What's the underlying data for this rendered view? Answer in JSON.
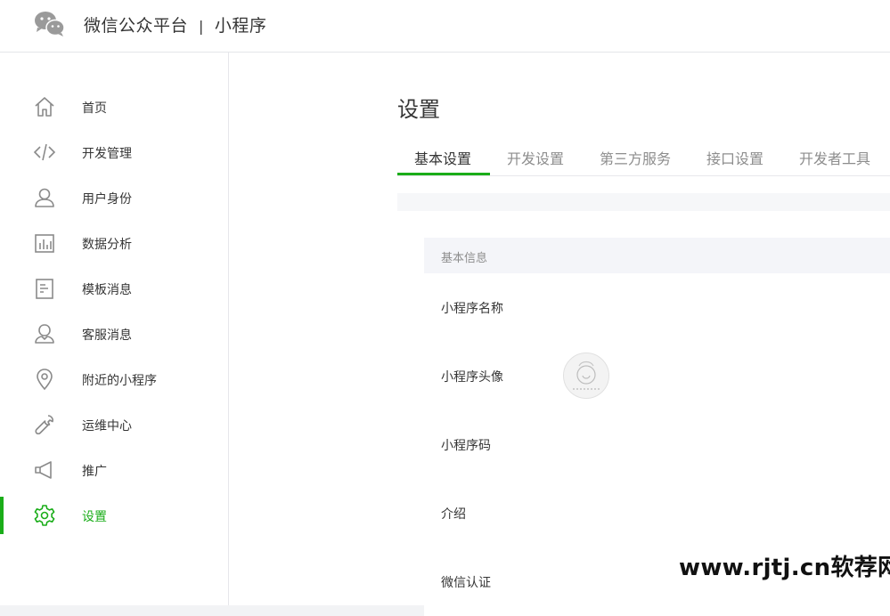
{
  "header": {
    "brand": "微信公众平台",
    "separator": "|",
    "product": "小程序"
  },
  "sidebar": {
    "active_color": "#1aad19",
    "items": [
      {
        "label": "首页",
        "icon": "home-icon"
      },
      {
        "label": "开发管理",
        "icon": "code-icon"
      },
      {
        "label": "用户身份",
        "icon": "user-icon"
      },
      {
        "label": "数据分析",
        "icon": "bar-chart-icon"
      },
      {
        "label": "模板消息",
        "icon": "document-icon"
      },
      {
        "label": "客服消息",
        "icon": "customer-service-icon"
      },
      {
        "label": "附近的小程序",
        "icon": "location-pin-icon"
      },
      {
        "label": "运维中心",
        "icon": "wrench-icon"
      },
      {
        "label": "推广",
        "icon": "megaphone-icon"
      },
      {
        "label": "设置",
        "icon": "gear-icon",
        "active": true
      }
    ]
  },
  "main": {
    "title": "设置",
    "tabs": [
      {
        "label": "基本设置",
        "active": true
      },
      {
        "label": "开发设置"
      },
      {
        "label": "第三方服务"
      },
      {
        "label": "接口设置"
      },
      {
        "label": "开发者工具"
      }
    ],
    "section": {
      "header": "基本信息",
      "rows": [
        {
          "label": "小程序名称"
        },
        {
          "label": "小程序头像"
        },
        {
          "label": "小程序码"
        },
        {
          "label": "介绍"
        },
        {
          "label": "微信认证"
        }
      ]
    }
  },
  "watermark": "www.rjtj.cn软荐网"
}
